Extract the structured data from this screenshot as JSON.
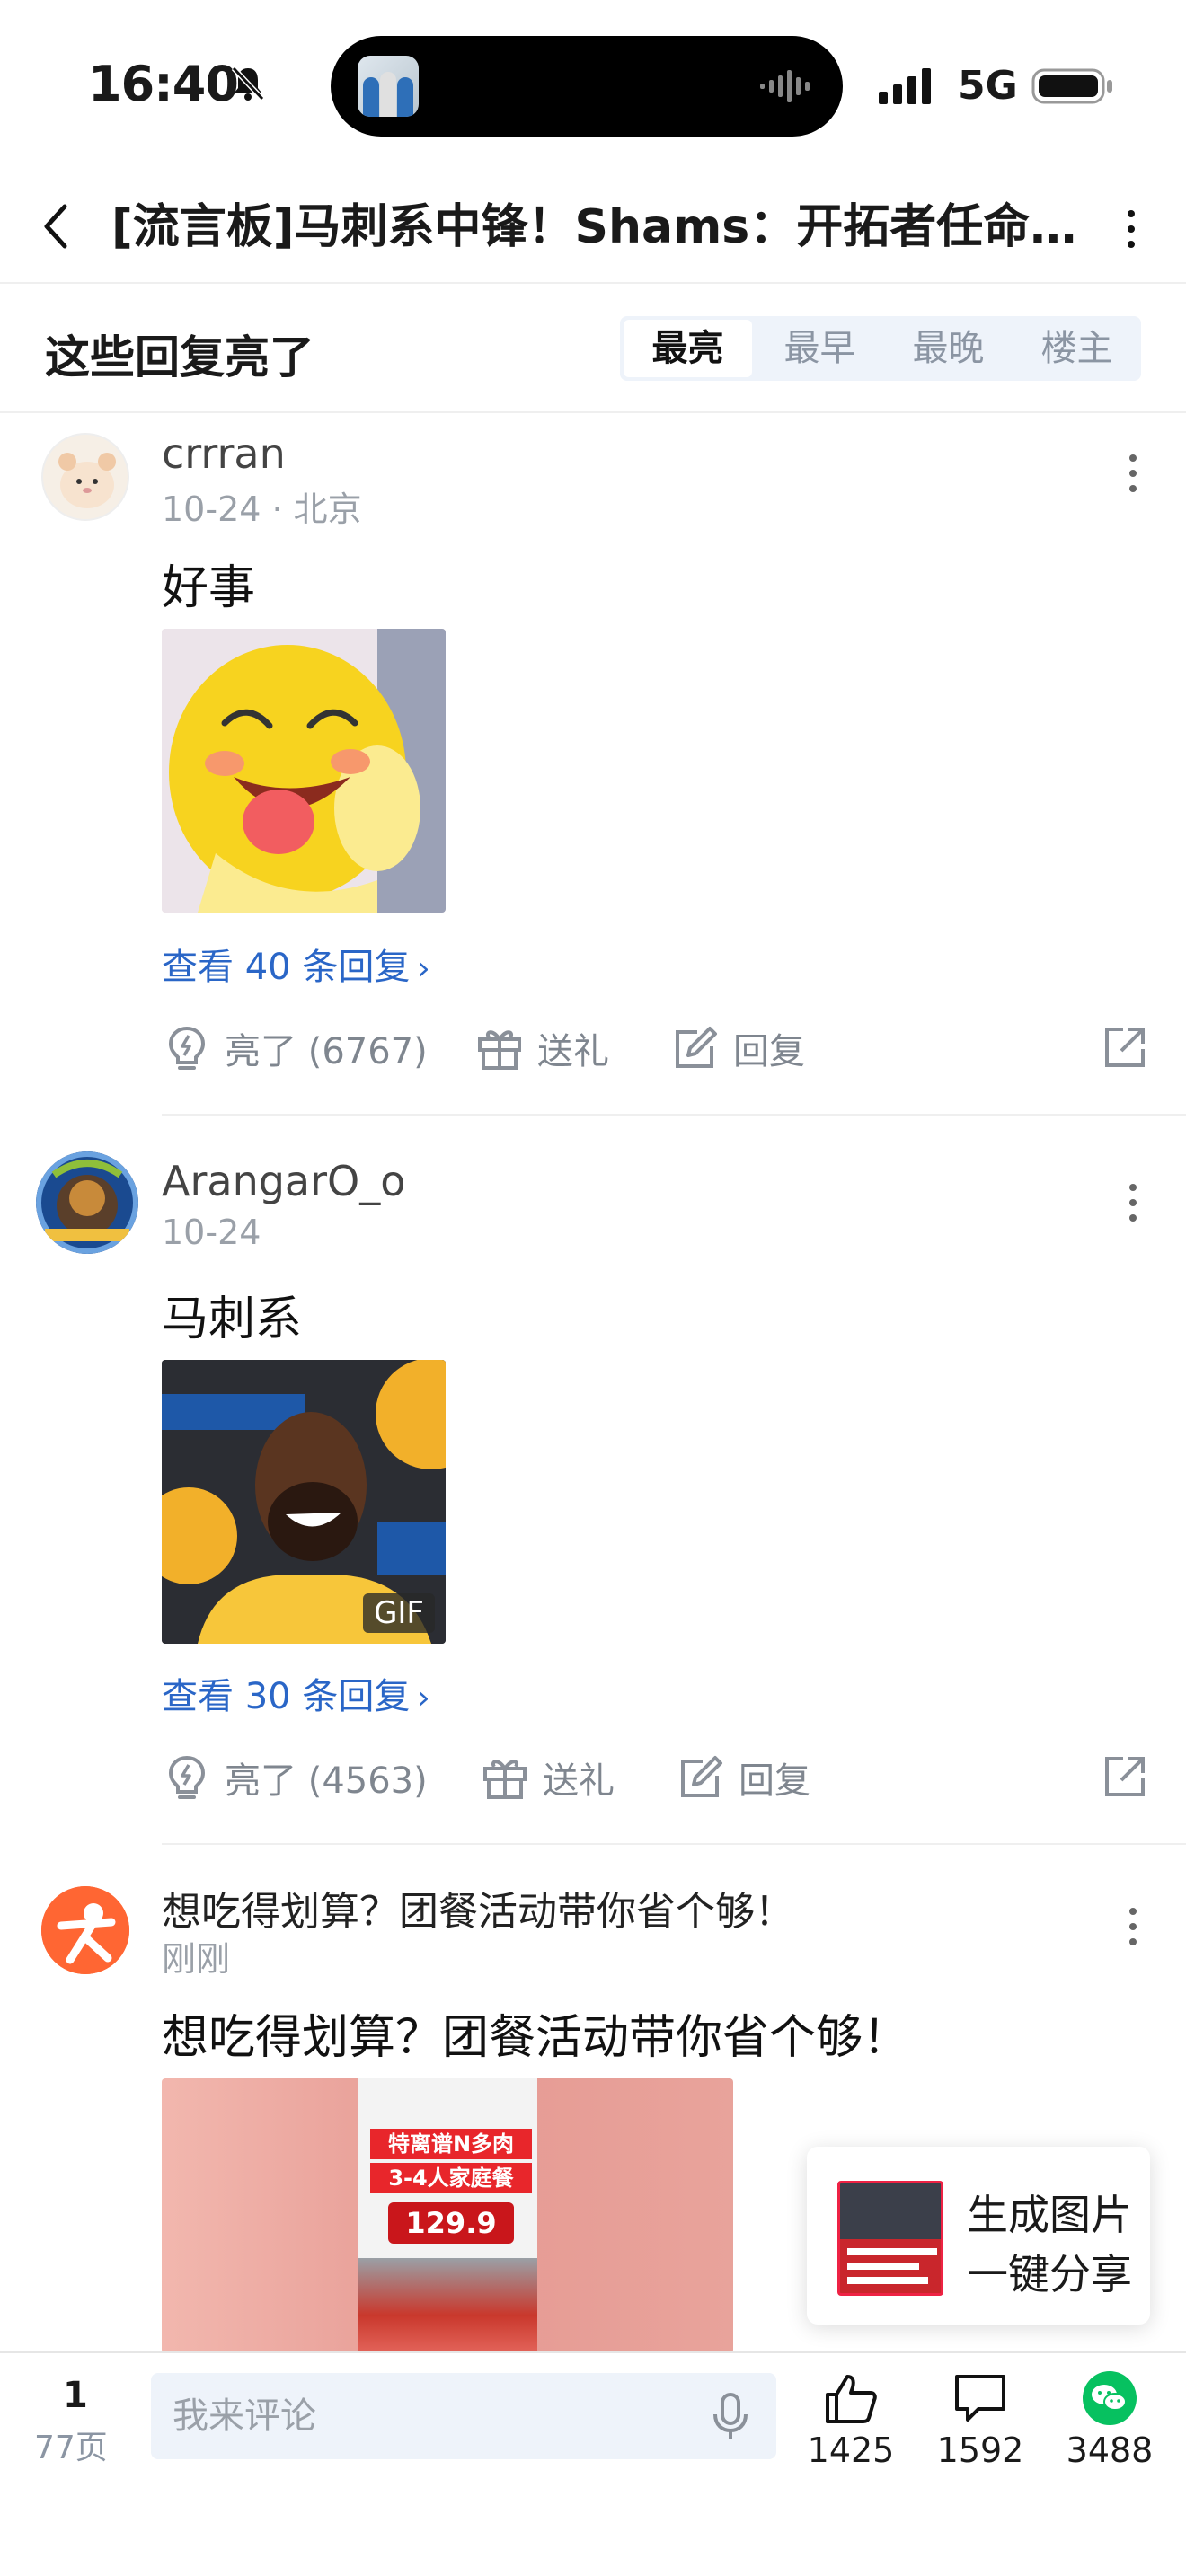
{
  "status_bar": {
    "time": "16:40",
    "network": "5G"
  },
  "nav": {
    "title": "[流言板]马刺系中锋！Shams：开拓者任命..."
  },
  "section": {
    "title": "这些回复亮了",
    "sort_tabs": [
      "最亮",
      "最早",
      "最晚",
      "楼主"
    ],
    "active_tab": "最亮"
  },
  "comments": [
    {
      "author": "crrran",
      "meta": "10-24 · 北京",
      "text": "好事",
      "view_replies": "查看 40 条回复",
      "like_label": "亮了 (6767)",
      "gift_label": "送礼",
      "reply_label": "回复"
    },
    {
      "author": "ArangarO_o",
      "meta": "10-24",
      "text": "马刺系",
      "gif_badge": "GIF",
      "view_replies": "查看 30 条回复",
      "like_label": "亮了 (4563)",
      "gift_label": "送礼",
      "reply_label": "回复"
    },
    {
      "author": "想吃得划算？团餐活动带你省个够！",
      "meta": "刚刚",
      "text": "想吃得划算？团餐活动带你省个够！",
      "ad_text_1": "特离谱N多肉",
      "ad_text_2": "3-4人家庭餐",
      "ad_price": "129.9"
    }
  ],
  "share_card": {
    "line1": "生成图片",
    "line2": "一键分享"
  },
  "bottom_bar": {
    "page": "1",
    "total_pages": "77页",
    "input_placeholder": "我来评论",
    "likes": "1425",
    "comments": "1592",
    "shares": "3488"
  },
  "colors": {
    "link": "#2a66c7",
    "muted": "#9aa0a8",
    "wechat": "#07c160",
    "ad_orange": "#ff6633"
  }
}
